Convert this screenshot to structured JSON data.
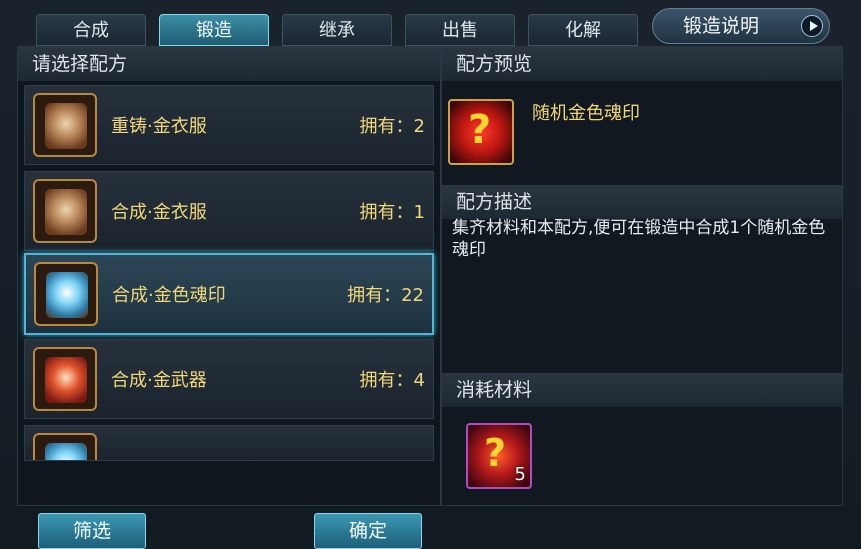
{
  "tabs": [
    {
      "label": "合成",
      "active": false
    },
    {
      "label": "锻造",
      "active": true
    },
    {
      "label": "继承",
      "active": false
    },
    {
      "label": "出售",
      "active": false
    },
    {
      "label": "化解",
      "active": false
    }
  ],
  "help_button": {
    "label": "锻造说明",
    "icon": "play-arrow-icon"
  },
  "left_panel": {
    "title": "请选择配方",
    "recipes": [
      {
        "name": "重铸·金衣服",
        "count": "拥有：2",
        "icon": "scroll-brown-icon",
        "selected": false
      },
      {
        "name": "合成·金衣服",
        "count": "拥有：1",
        "icon": "scroll-brown-icon",
        "selected": false
      },
      {
        "name": "合成·金色魂印",
        "count": "拥有：22",
        "icon": "scroll-blue-icon",
        "selected": true
      },
      {
        "name": "合成·金武器",
        "count": "拥有：4",
        "icon": "scroll-red-icon",
        "selected": false
      }
    ],
    "filter_label": "筛选",
    "confirm_label": "确定"
  },
  "right_panel": {
    "preview_title": "配方预览",
    "preview_item": {
      "name": "随机金色魂印",
      "icon": "mystery-red-orb-icon"
    },
    "desc_title": "配方描述",
    "description": "集齐材料和本配方,便可在锻造中合成1个随机金色魂印",
    "materials_title": "消耗材料",
    "material": {
      "count": "5",
      "icon": "mystery-red-orb-icon"
    }
  },
  "colors": {
    "accent": "#4fb8d6",
    "gold_text": "#f0d77a"
  }
}
